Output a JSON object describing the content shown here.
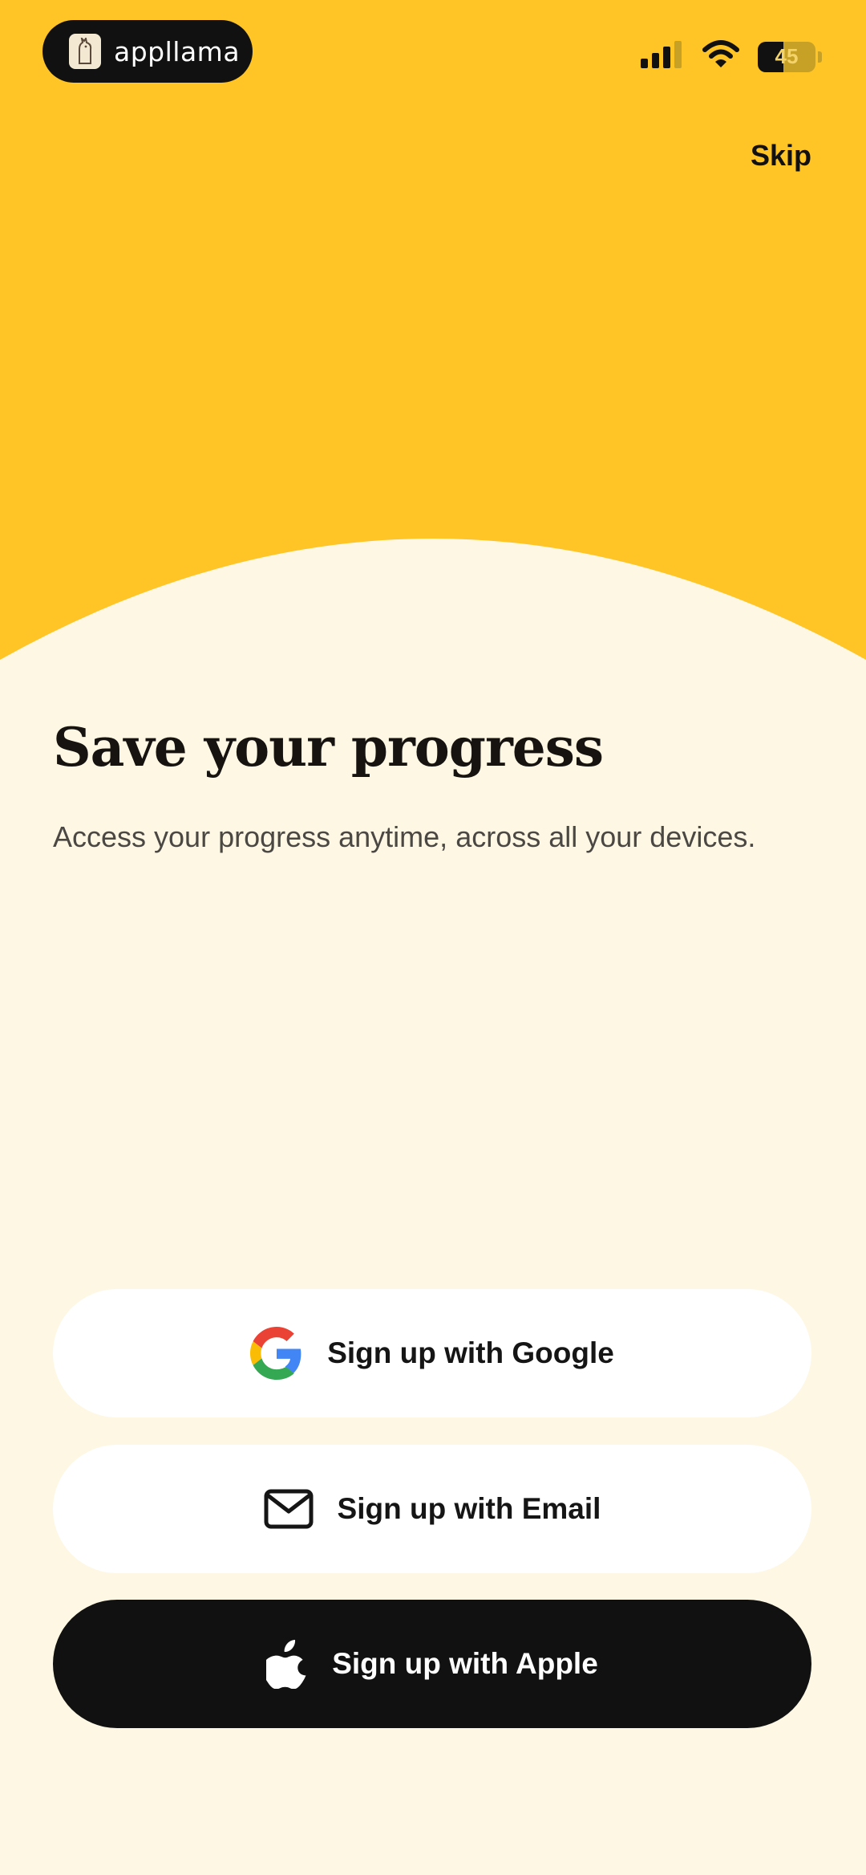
{
  "status_bar": {
    "app_name": "appllama",
    "battery_level": "45",
    "icons": [
      "cellular-signal-icon",
      "wifi-icon",
      "battery-icon"
    ]
  },
  "header": {
    "skip_label": "Skip"
  },
  "main": {
    "title": "Save your progress",
    "subtitle": "Access your progress anytime, across all your devices."
  },
  "actions": {
    "google_label": "Sign up with Google",
    "email_label": "Sign up with Email",
    "apple_label": "Sign up with Apple"
  },
  "colors": {
    "hero_yellow": "#FFC425",
    "background": "#FDF7E4",
    "apple_button": "#111111"
  }
}
